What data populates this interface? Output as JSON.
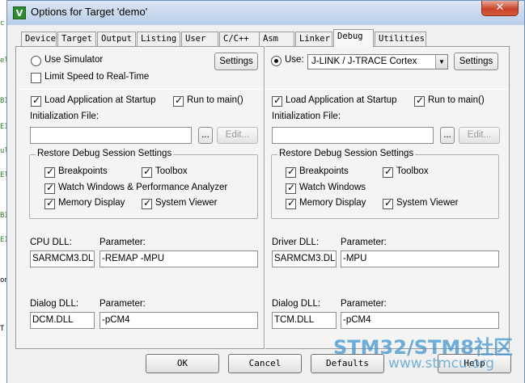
{
  "window": {
    "title": "Options for Target 'demo'",
    "icon_letter": "V",
    "close_glyph": "✕"
  },
  "tabs": [
    "Device",
    "Target",
    "Output",
    "Listing",
    "User",
    "C/C++",
    "Asm",
    "Linker",
    "Debug",
    "Utilities"
  ],
  "active_tab": "Debug",
  "simulator": {
    "use_label": "Use Simulator",
    "use_selected": false,
    "settings_label": "Settings",
    "limit_speed_label": "Limit Speed to Real-Time",
    "limit_speed_checked": false,
    "load_app_label": "Load Application at Startup",
    "load_app_checked": true,
    "run_main_label": "Run to main()",
    "run_main_checked": true,
    "init_file_label": "Initialization File:",
    "init_file_value": "",
    "browse_label": "...",
    "edit_label": "Edit...",
    "restore_group_label": "Restore Debug Session Settings",
    "restore": {
      "breakpoints": "Breakpoints",
      "toolbox": "Toolbox",
      "watch": "Watch Windows & Performance Analyzer",
      "memory": "Memory Display",
      "sysviewer": "System Viewer"
    },
    "cpu_dll_label": "CPU DLL:",
    "cpu_dll_value": "SARMCM3.DLL",
    "cpu_param_label": "Parameter:",
    "cpu_param_value": "-REMAP -MPU",
    "dialog_dll_label": "Dialog DLL:",
    "dialog_dll_value": "DCM.DLL",
    "dialog_param_label": "Parameter:",
    "dialog_param_value": "-pCM4"
  },
  "target": {
    "use_label": "Use:",
    "use_selected": true,
    "debugger": "J-LINK / J-TRACE Cortex",
    "settings_label": "Settings",
    "load_app_label": "Load Application at Startup",
    "load_app_checked": true,
    "run_main_label": "Run to main()",
    "run_main_checked": true,
    "init_file_label": "Initialization File:",
    "init_file_value": "",
    "browse_label": "...",
    "edit_label": "Edit...",
    "restore_group_label": "Restore Debug Session Settings",
    "restore": {
      "breakpoints": "Breakpoints",
      "toolbox": "Toolbox",
      "watch": "Watch Windows",
      "memory": "Memory Display",
      "sysviewer": "System Viewer"
    },
    "driver_dll_label": "Driver DLL:",
    "driver_dll_value": "SARMCM3.DLL",
    "driver_param_label": "Parameter:",
    "driver_param_value": "-MPU",
    "dialog_dll_label": "Dialog DLL:",
    "dialog_dll_value": "TCM.DLL",
    "dialog_param_label": "Parameter:",
    "dialog_param_value": "-pCM4"
  },
  "footer": {
    "ok": "OK",
    "cancel": "Cancel",
    "defaults": "Defaults",
    "help": "Help"
  },
  "watermark": {
    "text": "STM32/STM8社区",
    "url": "www.stmcu.org"
  },
  "background_marks": [
    "c",
    "el",
    "BI",
    "EI",
    "ul",
    "El",
    "BI",
    "EI",
    "on",
    "T"
  ],
  "check_glyph": "✓",
  "dropdown_glyph": "▼"
}
